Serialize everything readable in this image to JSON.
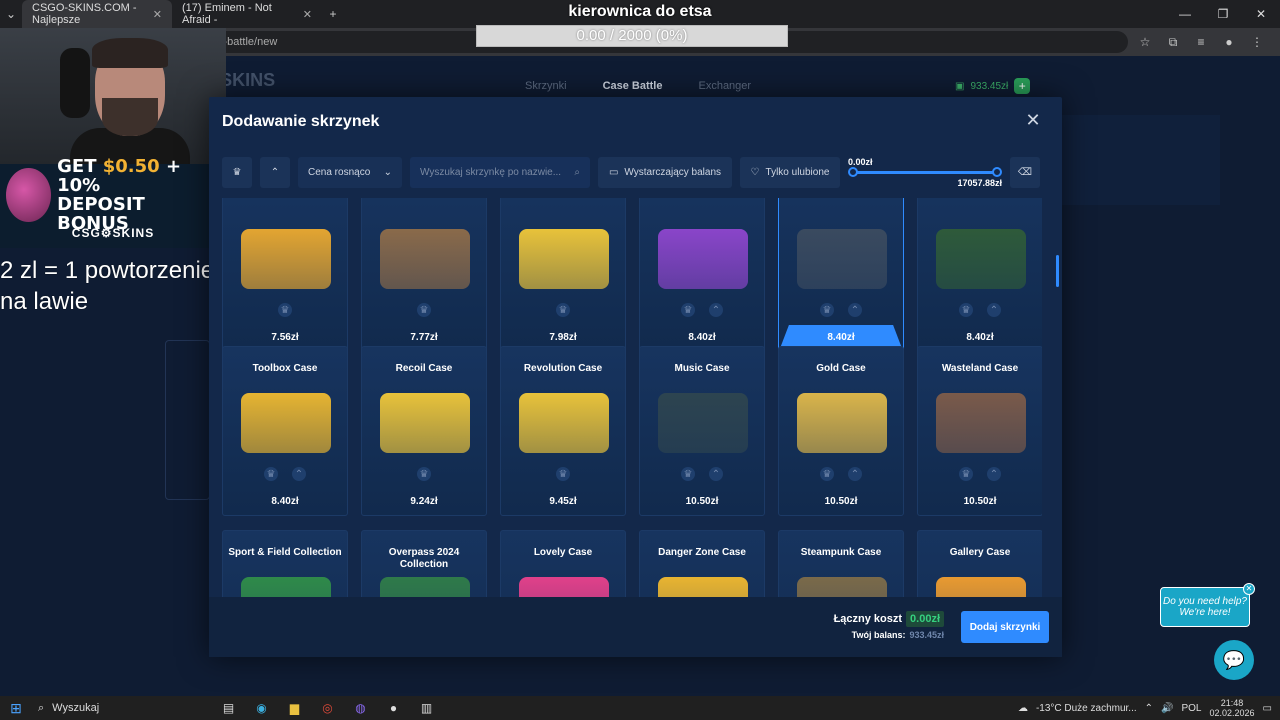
{
  "browser": {
    "tabs": [
      {
        "label": "CSGO-SKINS.COM - Najlepsze",
        "active": true
      },
      {
        "label": "(17) Eminem - Not Afraid -",
        "active": false
      }
    ],
    "url": "m/case-battle/new"
  },
  "overlay": {
    "goal_title": "kierownica do etsa",
    "goal_progress": "0.00 / 2000 (0%)",
    "goal_fraction": 0.0,
    "note_line1": "2 zl = 1 powtorzenie",
    "note_line2": "na lawie"
  },
  "promo": {
    "line1_pre": "GET ",
    "line1_amt": "$0.50",
    "line1_post": " + 10%",
    "line2": "DEPOSIT BONUS",
    "brand": "CSG⚙SKINS"
  },
  "site": {
    "logo": "G⚙SKINS",
    "nav": [
      "Skrzynki",
      "Case Battle",
      "Exchanger"
    ],
    "balance": "933.45zł"
  },
  "modal": {
    "title": "Dodawanie skrzynek",
    "filters": {
      "sort": "Cena rosnąco",
      "search_placeholder": "Wyszukaj skrzynkę po nazwie...",
      "balance_btn": "Wystarczający balans",
      "fav_btn": "Tylko ulubione",
      "range_min": "0.00zł",
      "range_max": "17057.88zł"
    },
    "cases_row1": [
      {
        "name": "",
        "price": "7.56zł",
        "color": "#e3a531"
      },
      {
        "name": "",
        "price": "7.77zł",
        "color": "#8a6a4a"
      },
      {
        "name": "",
        "price": "7.98zł",
        "color": "#e8c23a"
      },
      {
        "name": "",
        "price": "8.40zł",
        "color": "#8a45c9"
      },
      {
        "name": "",
        "price": "8.40zł",
        "color": "#3a4a5f",
        "selected": true
      },
      {
        "name": "",
        "price": "8.40zł",
        "color": "#2e5a3a"
      }
    ],
    "cases_row2": [
      {
        "name": "Toolbox Case",
        "price": "8.40zł",
        "color": "#e6b431"
      },
      {
        "name": "Recoil Case",
        "price": "9.24zł",
        "color": "#e8c23a"
      },
      {
        "name": "Revolution Case",
        "price": "9.45zł",
        "color": "#e8c23a"
      },
      {
        "name": "Music Case",
        "price": "10.50zł",
        "color": "#2d4450"
      },
      {
        "name": "Gold Case",
        "price": "10.50zł",
        "color": "#d9b44a"
      },
      {
        "name": "Wasteland Case",
        "price": "10.50zł",
        "color": "#7a5a4a"
      }
    ],
    "cases_row3": [
      {
        "name": "Sport & Field Collection",
        "price": "",
        "color": "#2f8a4a"
      },
      {
        "name": "Overpass 2024 Collection",
        "price": "",
        "color": "#2f7a4a"
      },
      {
        "name": "Lovely Case",
        "price": "",
        "color": "#e0408a"
      },
      {
        "name": "Danger Zone Case",
        "price": "",
        "color": "#e8b431"
      },
      {
        "name": "Steampunk Case",
        "price": "",
        "color": "#7a6a4a"
      },
      {
        "name": "Gallery Case",
        "price": "",
        "color": "#e89a31"
      }
    ],
    "footer": {
      "total_label": "Łączny koszt",
      "total_value": "0.00zł",
      "balance_label": "Twój balans:",
      "balance_value": "933.45zł",
      "add_btn": "Dodaj skrzynki"
    }
  },
  "chat": {
    "bubble": "Do you need help? We're here!"
  },
  "taskbar": {
    "search": "Wyszukaj",
    "weather": "-13°C  Duże zachmur...",
    "lang": "POL",
    "time": "21:48",
    "date": "02.02.2026"
  }
}
